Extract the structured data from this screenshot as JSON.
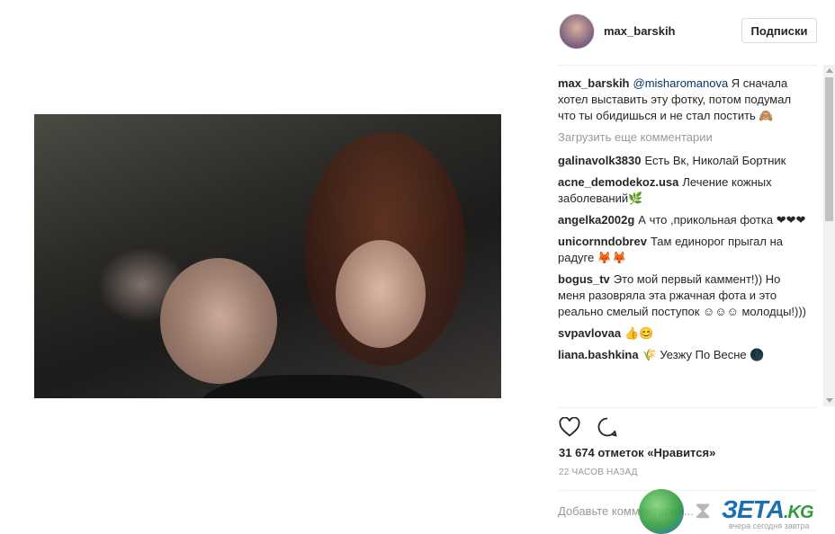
{
  "post": {
    "username": "max_barskih",
    "follow_label": "Подписки"
  },
  "caption": {
    "author": "max_barskih",
    "mention": "@misharomanova",
    "text": " Я сначала хотел выставить эту фотку, потом подумал что ты обидишься и не стал постить 🙈"
  },
  "load_more": "Загрузить еще комментарии",
  "comments": [
    {
      "author": "galinavolk3830",
      "text": "Есть Вк, Николай Бортник"
    },
    {
      "author": "acne_demodekoz.usa",
      "text": "Лечение кожных заболеваний🌿"
    },
    {
      "author": "angelka2002g",
      "text": "А что ,прикольная фотка ❤❤❤"
    },
    {
      "author": "unicornndobrev",
      "text": "Там единорог прыгал на радуге 🦊🦊"
    },
    {
      "author": "bogus_tv",
      "text": "Это мой первый каммент!)) Но меня разовряла эта ржачная фота и это реально смелый поступок ☺☺☺ молодцы!)))"
    },
    {
      "author": "svpavlovaa",
      "text": "👍😊"
    },
    {
      "author": "liana.bashkina",
      "text": "🌾 Уезжу По Весне 🌑"
    }
  ],
  "likes": "31 674 отметок «Нравится»",
  "time": "22 ЧАСОВ НАЗАД",
  "add_comment_placeholder": "Добавьте комментарий...",
  "icons": {
    "like": "heart-icon",
    "comment": "comment-icon"
  },
  "watermark": {
    "brand": "ЗЕТА",
    "tld": ".KG",
    "tagline": "вчера сегодня завтра"
  },
  "colors": {
    "mention": "#003569",
    "muted": "#999999",
    "text": "#262626"
  }
}
